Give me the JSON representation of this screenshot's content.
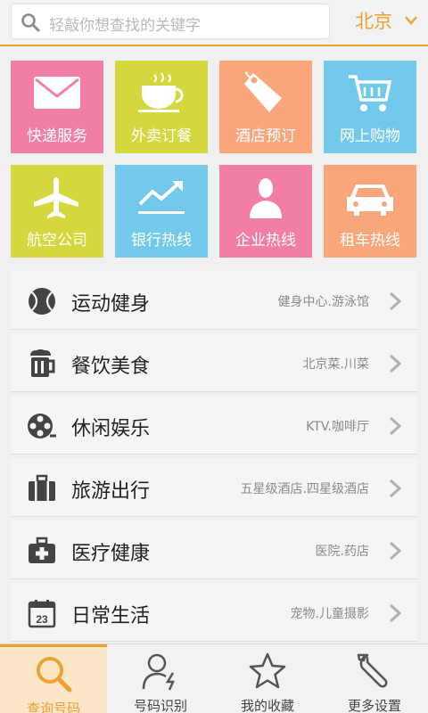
{
  "search": {
    "placeholder": "轻敲你想查找的关键字"
  },
  "city": "北京",
  "tiles": [
    {
      "label": "快递服务",
      "icon": "envelope-icon",
      "color": "#f27ea3"
    },
    {
      "label": "外卖订餐",
      "icon": "coffee-cup-icon",
      "color": "#d4d83e"
    },
    {
      "label": "酒店预订",
      "icon": "price-tag-icon",
      "color": "#f9a67b"
    },
    {
      "label": "网上购物",
      "icon": "shopping-cart-icon",
      "color": "#72c9ec"
    },
    {
      "label": "航空公司",
      "icon": "airplane-icon",
      "color": "#d4d83e"
    },
    {
      "label": "银行热线",
      "icon": "trend-chart-icon",
      "color": "#72c9ec"
    },
    {
      "label": "企业热线",
      "icon": "person-icon",
      "color": "#f27ea3"
    },
    {
      "label": "租车热线",
      "icon": "car-icon",
      "color": "#f9a67b"
    }
  ],
  "categories": [
    {
      "name": "运动健身",
      "sub": "健身中心.游泳馆",
      "icon": "tennis-ball-icon"
    },
    {
      "name": "餐饮美食",
      "sub": "北京菜.川菜",
      "icon": "beer-mug-icon"
    },
    {
      "name": "休闲娱乐",
      "sub": "KTV.咖啡厅",
      "icon": "film-reel-icon"
    },
    {
      "name": "旅游出行",
      "sub": "五星级酒店.四星级酒店",
      "icon": "luggage-icon"
    },
    {
      "name": "医疗健康",
      "sub": "医院.药店",
      "icon": "medical-kit-icon"
    },
    {
      "name": "日常生活",
      "sub": "宠物.儿童摄影",
      "icon": "calendar-icon",
      "icon_text": "23"
    }
  ],
  "tabs": [
    {
      "label": "查询号码",
      "icon": "search-icon",
      "active": true
    },
    {
      "label": "号码识别",
      "icon": "caller-id-icon",
      "active": false
    },
    {
      "label": "我的收藏",
      "icon": "star-icon",
      "active": false
    },
    {
      "label": "更多设置",
      "icon": "wrench-icon",
      "active": false
    }
  ],
  "colors": {
    "accent": "#f0a030",
    "active_tab_bg": "#fbe7c7"
  }
}
